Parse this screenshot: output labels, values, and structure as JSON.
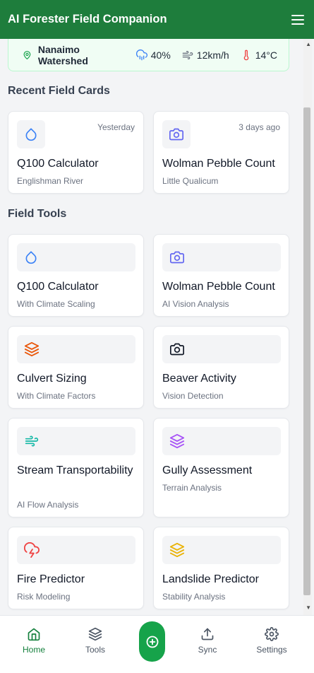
{
  "header": {
    "title": "AI Forester Field Companion"
  },
  "weather": {
    "location": "Nanaimo Watershed",
    "precip": "40%",
    "wind": "12km/h",
    "temp": "14°C"
  },
  "recent": {
    "title": "Recent Field Cards",
    "cards": [
      {
        "time": "Yesterday",
        "name": "Q100 Calculator",
        "sub": "Englishman River",
        "icon": "droplet-icon"
      },
      {
        "time": "3 days ago",
        "name": "Wolman Pebble Count",
        "sub": "Little Qualicum",
        "icon": "camera-icon"
      }
    ]
  },
  "tools": {
    "title": "Field Tools",
    "cards": [
      {
        "name": "Q100 Calculator",
        "sub": "With Climate Scaling",
        "icon": "droplet-icon"
      },
      {
        "name": "Wolman Pebble Count",
        "sub": "AI Vision Analysis",
        "icon": "camera-icon"
      },
      {
        "name": "Culvert Sizing",
        "sub": "With Climate Factors",
        "icon": "layers-icon"
      },
      {
        "name": "Beaver Activity",
        "sub": "Vision Detection",
        "icon": "camera-icon"
      },
      {
        "name": "Stream Transportability",
        "sub": "AI Flow Analysis",
        "icon": "wind-icon"
      },
      {
        "name": "Gully Assessment",
        "sub": "Terrain Analysis",
        "icon": "layers-icon"
      },
      {
        "name": "Fire Predictor",
        "sub": "Risk Modeling",
        "icon": "cloud-lightning-icon"
      },
      {
        "name": "Landslide Predictor",
        "sub": "Stability Analysis",
        "icon": "layers-icon"
      }
    ]
  },
  "nav": {
    "home": "Home",
    "tools": "Tools",
    "sync": "Sync",
    "settings": "Settings"
  },
  "colors": {
    "header": "#1e7d3c",
    "accent": "#16a34a",
    "droplet": "#3b82f6",
    "camera": "#6366f1",
    "layers_orange": "#ea580c",
    "camera_black": "#111827",
    "wind": "#14b8a6",
    "layers_purple": "#a855f7",
    "fire": "#ef4444",
    "layers_yellow": "#eab308"
  }
}
